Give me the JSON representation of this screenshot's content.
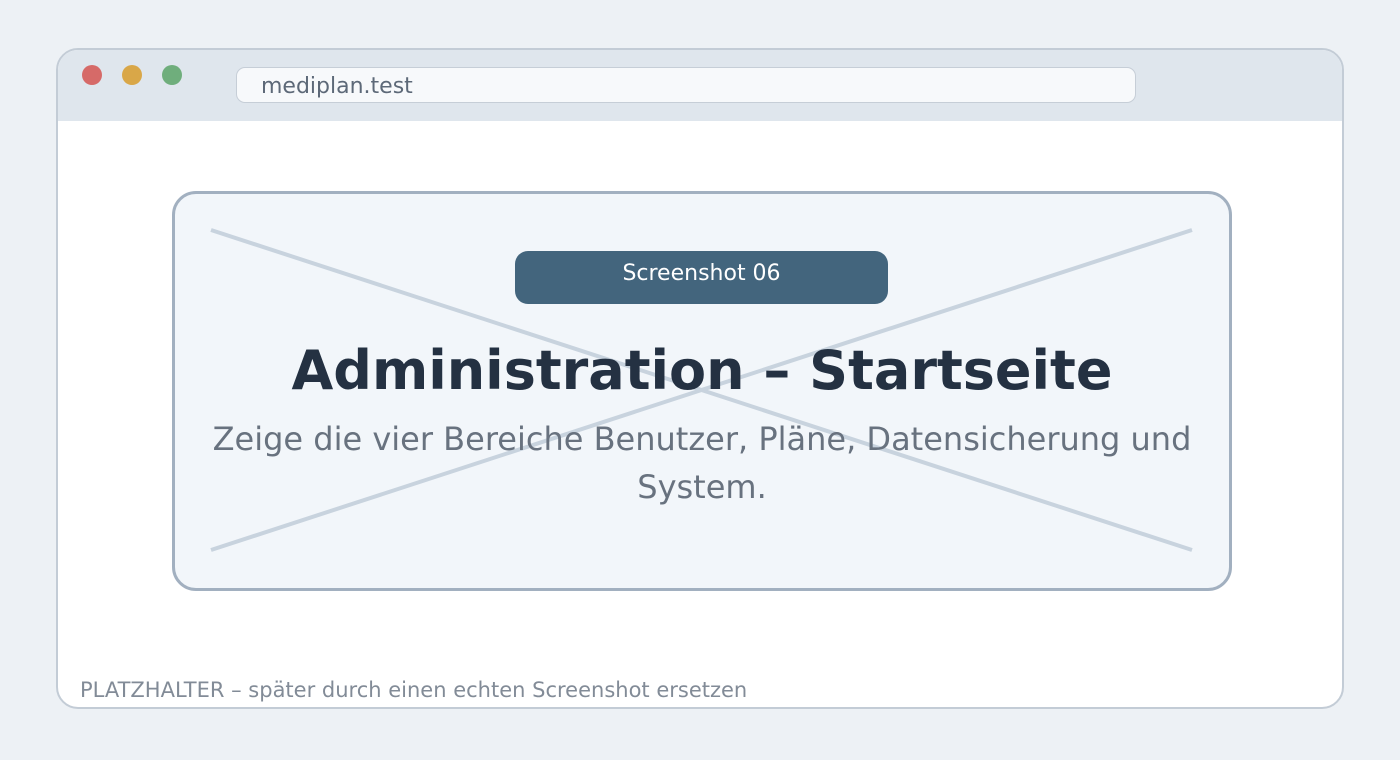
{
  "browser": {
    "address": "mediplan.test",
    "window_controls": [
      "close-dot",
      "minimize-dot",
      "maximize-dot"
    ],
    "colors": {
      "close": "#d66a68",
      "minimize": "#d9a748",
      "maximize": "#6fae7c"
    }
  },
  "placeholder": {
    "badge": "Screenshot 06",
    "title": "Administration – Startseite",
    "description": "Zeige die vier Bereiche Benutzer, Pläne, Datensicherung und System.",
    "colors": {
      "badge_background": "#43657d",
      "title": "#243142",
      "description": "#68727f",
      "box_border": "#a2b0c0"
    }
  },
  "footer": {
    "note": "PLATZHALTER – später durch einen echten Screenshot ersetzen"
  }
}
